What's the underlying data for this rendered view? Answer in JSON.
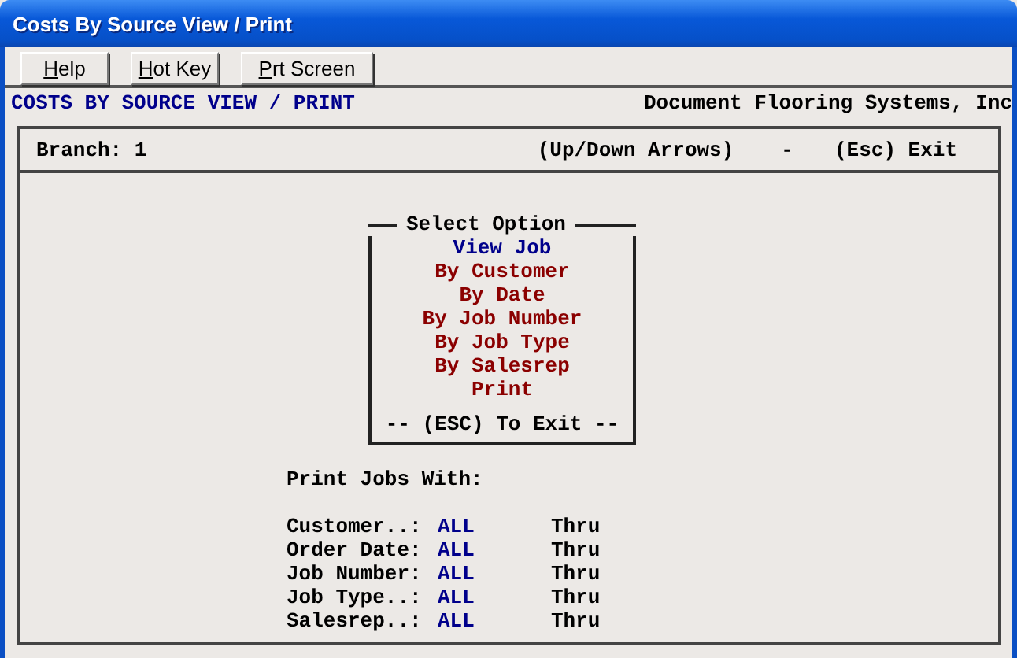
{
  "window": {
    "title": "Costs By Source View / Print"
  },
  "toolbar": {
    "buttons": [
      {
        "label_parts": [
          {
            "text": "H",
            "underlined": true
          },
          {
            "text": "elp",
            "underlined": false
          }
        ]
      },
      {
        "label_parts": [
          {
            "text": "H",
            "underlined": true
          },
          {
            "text": "ot Key",
            "underlined": false
          }
        ]
      },
      {
        "label_parts": [
          {
            "text": "P",
            "underlined": true
          },
          {
            "text": "rt Screen",
            "underlined": false
          }
        ]
      }
    ]
  },
  "header": {
    "title": "COSTS BY SOURCE VIEW / PRINT",
    "company": "Document Flooring Systems, Inc"
  },
  "status_row": {
    "branch": "Branch: 1",
    "hint": "(Up/Down Arrows)",
    "separator": "-",
    "exit": "(Esc) Exit"
  },
  "menu": {
    "title": "Select Option",
    "items": [
      {
        "label": "View Job",
        "selected": true
      },
      {
        "label": "By Customer",
        "selected": false
      },
      {
        "label": "By Date",
        "selected": false
      },
      {
        "label": "By Job Number",
        "selected": false
      },
      {
        "label": "By Job Type",
        "selected": false
      },
      {
        "label": "By Salesrep",
        "selected": false
      },
      {
        "label": "Print",
        "selected": false
      }
    ],
    "footer": "-- (ESC) To Exit --"
  },
  "criteria": {
    "heading": "Print Jobs With:",
    "rows": [
      {
        "label": "Customer..:",
        "value": "ALL",
        "thru": "Thru"
      },
      {
        "label": "Order Date:",
        "value": "ALL",
        "thru": "Thru"
      },
      {
        "label": "Job Number:",
        "value": "ALL",
        "thru": "Thru"
      },
      {
        "label": "Job Type..:",
        "value": "ALL",
        "thru": "Thru"
      },
      {
        "label": "Salesrep..:",
        "value": "ALL",
        "thru": "Thru"
      }
    ]
  }
}
